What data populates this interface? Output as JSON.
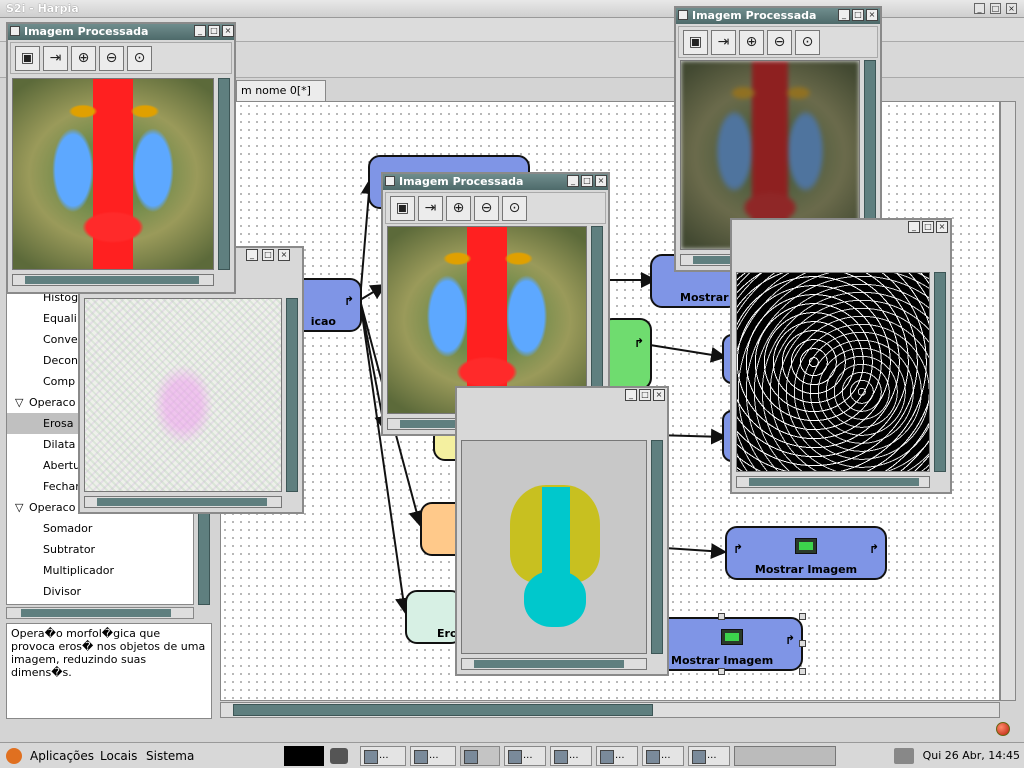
{
  "window": {
    "title": "S2i - Harpia"
  },
  "tab": {
    "label": "m nome 0[*]"
  },
  "sidebar": {
    "items": [
      {
        "label": "Histog",
        "type": "item",
        "top": 0
      },
      {
        "label": "Equali",
        "type": "item"
      },
      {
        "label": "Conve",
        "type": "item"
      },
      {
        "label": "Decon",
        "type": "item"
      },
      {
        "label": "Comp",
        "type": "item"
      },
      {
        "label": "Operaco",
        "type": "group"
      },
      {
        "label": "Erosa",
        "type": "item",
        "selected": true
      },
      {
        "label": "Dilata",
        "type": "item"
      },
      {
        "label": "Abertu",
        "type": "item"
      },
      {
        "label": "Fechar",
        "type": "item"
      },
      {
        "label": "Operaco",
        "type": "group"
      },
      {
        "label": "Somador",
        "type": "item"
      },
      {
        "label": "Subtrator",
        "type": "item"
      },
      {
        "label": "Multiplicador",
        "type": "item"
      },
      {
        "label": "Divisor",
        "type": "item"
      }
    ],
    "group_arrow": "▽"
  },
  "description": {
    "text": "Opera�o morfol�gica que provoca eros� nos objetos de uma imagem, reduzindo suas dimens�s."
  },
  "blocks": {
    "aquisicao_label": "icao",
    "mostrar1_label": "Mostrar",
    "mostrar2_label": "Mostrar Imagem",
    "mostrar3_label": "Mostrar Imagem",
    "erosao_label": "Ero",
    "port_glyph": "↱"
  },
  "windows": {
    "w1_title": "Imagem Processada",
    "w2_title": "Imagem Processada",
    "w3_title": "Imagem Processada",
    "btn_min": "_",
    "btn_max": "□",
    "btn_close": "×"
  },
  "toolbar_icons": [
    "save-icon",
    "export-icon",
    "zoom-in-icon",
    "zoom-out-icon",
    "zoom-fit-icon"
  ],
  "toolbar_glyphs": {
    "save": "▣",
    "export": "⇥",
    "zoom_in": "⊕",
    "zoom_out": "⊖",
    "zoom_fit": "⊙"
  },
  "panel": {
    "applications": "Aplicações",
    "places": "Locais",
    "system": "Sistema",
    "clock": "Qui 26 Abr, 14:45",
    "task_label": "..."
  },
  "colors": {
    "block_blue": "#7f95e6",
    "block_green": "#6fdc6f",
    "block_orange": "#ffc98a",
    "block_mint": "#d7f0e4",
    "scroll_teal": "#5f7f7f"
  }
}
